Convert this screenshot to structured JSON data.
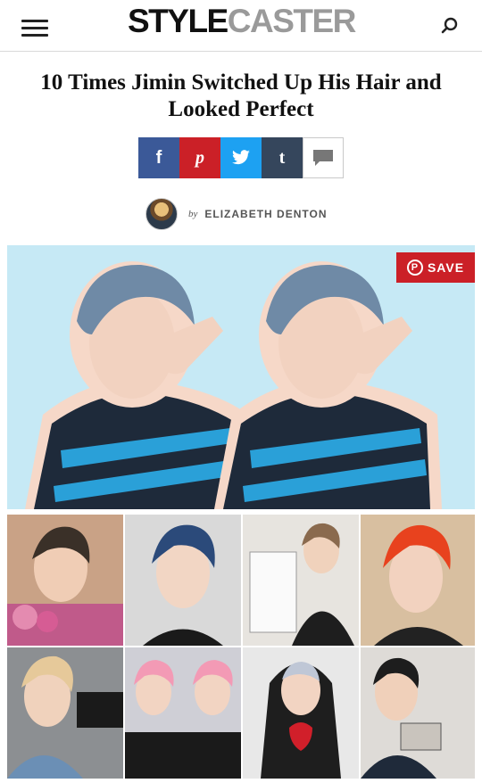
{
  "header": {
    "logo_style": "STYLE",
    "logo_caster": "CASTER",
    "menu_icon": "hamburger-menu-icon",
    "search_icon": "search-icon"
  },
  "article": {
    "title": "10 Times Jimin Switched Up His Hair and Looked Perfect",
    "byline_prefix": "by",
    "author": "ELIZABETH DENTON"
  },
  "share": {
    "facebook": "f",
    "pinterest": "p",
    "twitter": "twitter-bird-icon",
    "tumblr": "t",
    "comment": "comment-icon"
  },
  "hero": {
    "save_label": "SAVE",
    "save_icon": "pinterest-icon"
  },
  "colors": {
    "facebook": "#3b5998",
    "pinterest": "#cb2027",
    "twitter": "#1da1f2",
    "tumblr": "#35465c",
    "hero_background": "#c6e9f5"
  }
}
